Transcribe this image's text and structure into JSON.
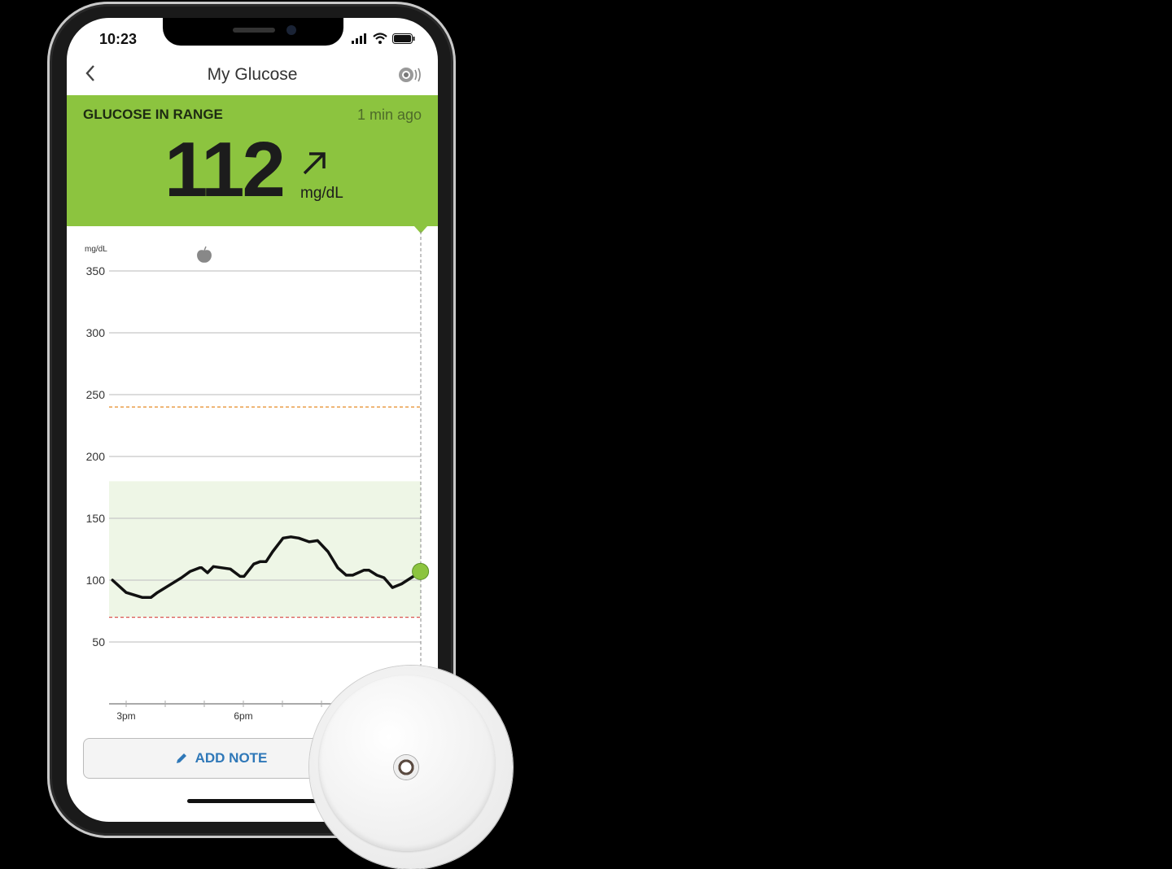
{
  "status_bar": {
    "time": "10:23",
    "icons": [
      "signal-icon",
      "wifi-icon",
      "battery-icon"
    ]
  },
  "nav": {
    "title": "My Glucose",
    "back_icon": "chevron-left-icon",
    "sensor_icon": "sensor-sound-icon"
  },
  "banner": {
    "label": "GLUCOSE IN RANGE",
    "updated": "1 min ago",
    "reading": "112",
    "unit": "mg/dL",
    "trend": "arrow-up-right-icon",
    "color": "#8cc43f"
  },
  "add_note": {
    "label": "ADD NOTE",
    "icon": "pencil-icon",
    "color": "#2f78b8"
  },
  "chart_data": {
    "type": "line",
    "ylabel": "mg/dL",
    "ylim": [
      0,
      350
    ],
    "yticks": [
      50,
      100,
      150,
      200,
      250,
      300,
      350
    ],
    "xtick_labels": [
      "3pm",
      "6pm"
    ],
    "grid": true,
    "target_range": [
      70,
      180
    ],
    "high_threshold": 240,
    "low_threshold": 70,
    "colors": {
      "line": "#111111",
      "range": "#eef6e6",
      "high": "#e8963a",
      "low": "#d9534f",
      "current": "#8cc43f"
    },
    "meal_marker": {
      "x": "17:00",
      "icon": "apple-icon"
    },
    "x": [
      "14:39",
      "15:00",
      "15:25",
      "15:38",
      "15:48",
      "16:25",
      "16:38",
      "16:53",
      "16:56",
      "17:05",
      "17:14",
      "17:40",
      "17:55",
      "18:01",
      "18:16",
      "18:26",
      "18:35",
      "18:45",
      "19:01",
      "19:13",
      "19:25",
      "19:41",
      "19:54",
      "20:10",
      "20:25",
      "20:38",
      "20:48",
      "21:05",
      "21:13",
      "21:25",
      "21:36",
      "21:49",
      "22:03",
      "22:21",
      "22:32"
    ],
    "y": [
      100,
      90,
      86,
      86,
      90,
      102,
      107,
      110,
      110,
      106,
      111,
      109,
      103,
      103,
      113,
      115,
      115,
      123,
      134,
      135,
      134,
      131,
      132,
      123,
      110,
      104,
      104,
      108,
      108,
      104,
      102,
      94,
      97,
      103,
      107
    ]
  }
}
